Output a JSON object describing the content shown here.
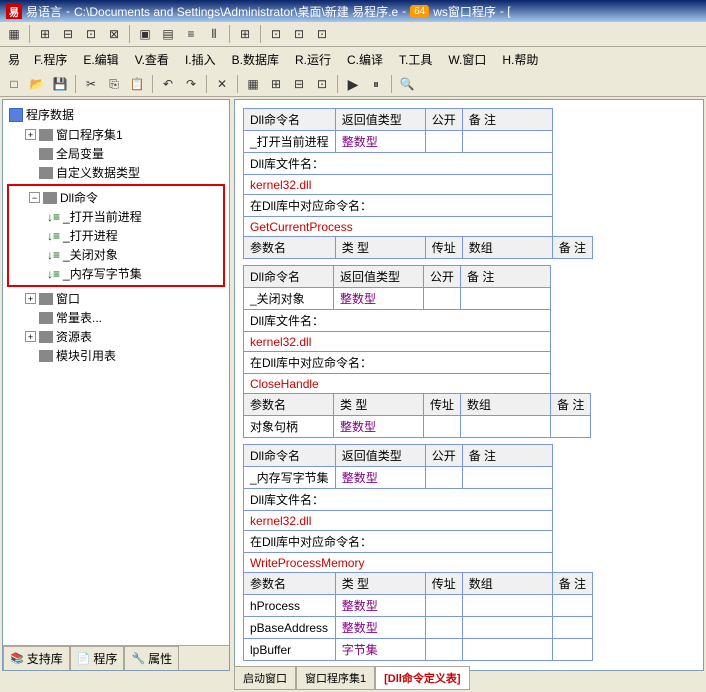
{
  "title_app": "易语言",
  "title_path": "C:\\Documents and Settings\\Administrator\\桌面\\新建 易程序.e",
  "title_suffix": "ws窗口程序",
  "badge": "64",
  "menu": {
    "f": "F.程序",
    "e": "E.编辑",
    "v": "V.查看",
    "i": "I.插入",
    "b": "B.数据库",
    "r": "R.运行",
    "c": "C.编译",
    "t": "T.工具",
    "w": "W.窗口",
    "h": "H.帮助"
  },
  "tree": {
    "root": "程序数据",
    "items1": [
      "窗口程序集1",
      "全局变量",
      "自定义数据类型"
    ],
    "dll_root": "Dll命令",
    "dll_items": [
      "_打开当前进程",
      "_打开进程",
      "_关闭对象",
      "_内存写字节集"
    ],
    "items2": [
      "窗口",
      "常量表...",
      "资源表",
      "模块引用表"
    ]
  },
  "side_tabs": [
    "支持库",
    "程序",
    "属性"
  ],
  "bottom_tabs": [
    "启动窗口",
    "窗口程序集1",
    "[Dll命令定义表]"
  ],
  "headers": {
    "cmd": "Dll命令名",
    "ret": "返回值类型",
    "pub": "公开",
    "note": "备 注",
    "file": "Dll库文件名：",
    "corr": "在Dll库中对应命令名：",
    "param": "参数名",
    "type": "类 型",
    "addr": "传址",
    "arr": "数组"
  },
  "vals": {
    "int": "整数型",
    "bytes": "字节集",
    "kernel": "kernel32.dll",
    "cmd1": "_打开当前进程",
    "api1": "GetCurrentProcess",
    "cmd2": "_关闭对象",
    "api2": "CloseHandle",
    "p2": "对象句柄",
    "cmd3": "_内存写字节集",
    "api3": "WriteProcessMemory",
    "p3a": "hProcess",
    "p3b": "pBaseAddress",
    "p3c": "lpBuffer"
  }
}
